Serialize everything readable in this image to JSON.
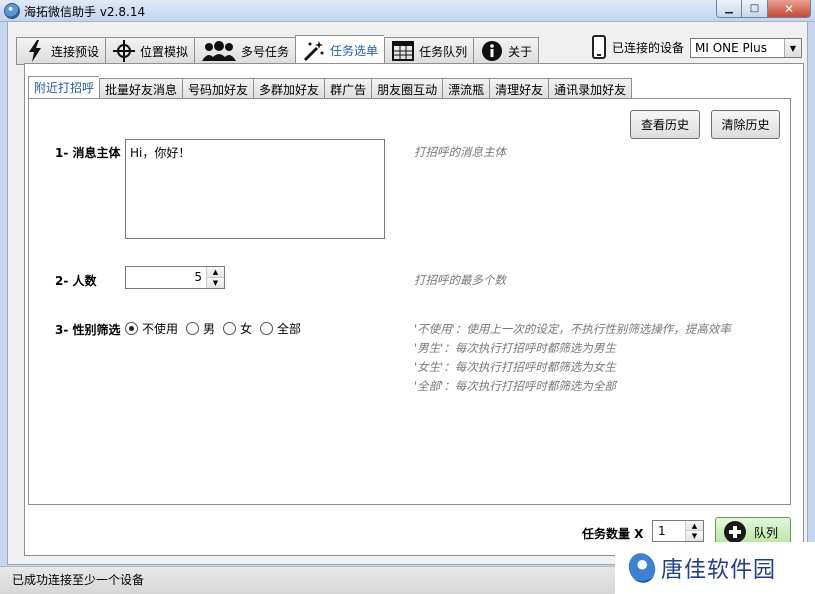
{
  "window": {
    "title": "海拓微信助手 v2.8.14"
  },
  "top_tabs": [
    {
      "label": "连接预设",
      "icon": "lightning-icon"
    },
    {
      "label": "位置模拟",
      "icon": "crosshair-icon"
    },
    {
      "label": "多号任务",
      "icon": "users-icon"
    },
    {
      "label": "任务选单",
      "icon": "magic-wand-icon",
      "active": true
    },
    {
      "label": "任务队列",
      "icon": "table-icon"
    },
    {
      "label": "关于",
      "icon": "info-icon"
    }
  ],
  "device": {
    "label": "已连接的设备",
    "selected": "MI ONE Plus"
  },
  "sub_tabs": [
    {
      "label": "附近打招呼",
      "active": true
    },
    {
      "label": "批量好友消息"
    },
    {
      "label": "号码加好友"
    },
    {
      "label": "多群加好友"
    },
    {
      "label": "群广告"
    },
    {
      "label": "朋友圈互动"
    },
    {
      "label": "漂流瓶"
    },
    {
      "label": "清理好友"
    },
    {
      "label": "通讯录加好友"
    }
  ],
  "buttons": {
    "view_history": "查看历史",
    "clear_history": "清除历史",
    "queue": "队列"
  },
  "form": {
    "message": {
      "label": "1- 消息主体",
      "value": "Hi，你好！",
      "hint": "打招呼的消息主体"
    },
    "count": {
      "label": "2- 人数",
      "value": "5",
      "hint": "打招呼的最多个数"
    },
    "gender": {
      "label": "3- 性别筛选",
      "options": [
        "不使用",
        "男",
        "女",
        "全部"
      ],
      "selected": "不使用",
      "hints": [
        "'不使用'：使用上一次的设定，不执行性别筛选操作，提高效率",
        "'男生'：每次执行打招呼时都筛选为男生",
        "'女生'：每次执行打招呼时都筛选为女生",
        "'全部'：每次执行打招呼时都筛选为全部"
      ]
    }
  },
  "task_count": {
    "label": "任务数量 X",
    "value": "1"
  },
  "status": {
    "text": "已成功连接至少一个设备"
  },
  "watermark": {
    "text": "唐佳软件园"
  }
}
